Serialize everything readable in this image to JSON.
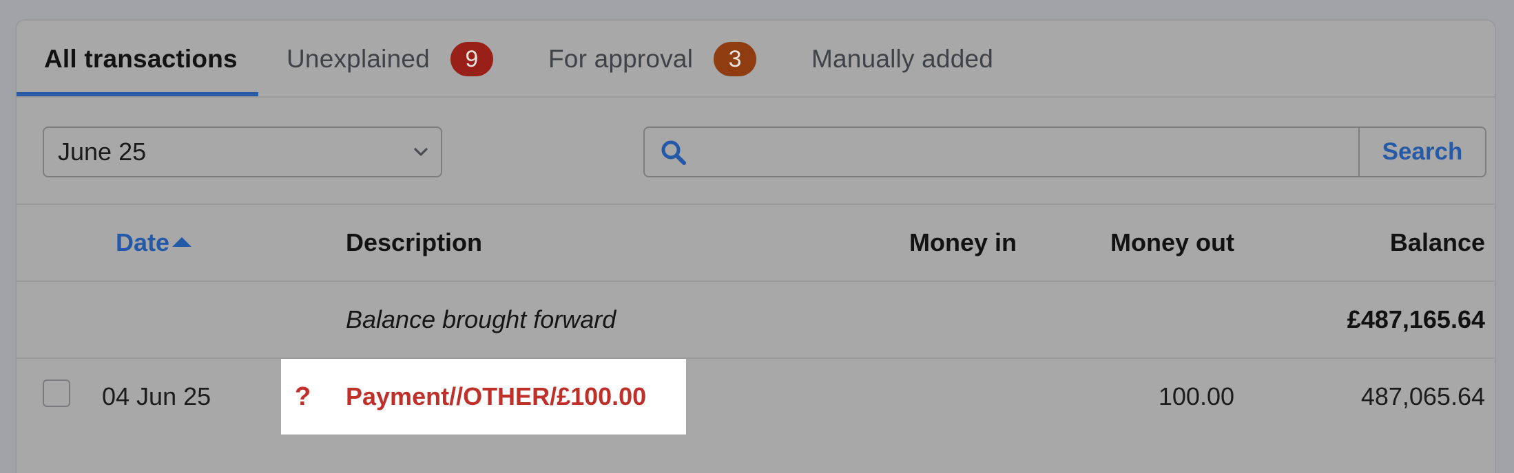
{
  "tabs": [
    {
      "label": "All transactions",
      "active": true
    },
    {
      "label": "Unexplained",
      "badge": "9",
      "badge_color": "#992018"
    },
    {
      "label": "For approval",
      "badge": "3",
      "badge_color": "#8f3d10"
    },
    {
      "label": "Manually added"
    }
  ],
  "filters": {
    "period_value": "June 25",
    "search_value": "",
    "search_button": "Search"
  },
  "table": {
    "columns": {
      "date": "Date",
      "description": "Description",
      "money_in": "Money in",
      "money_out": "Money out",
      "balance": "Balance"
    },
    "sort": {
      "column": "date",
      "direction": "ascending"
    },
    "carry_forward": {
      "description": "Balance brought forward",
      "balance": "£487,165.64"
    },
    "rows": [
      {
        "date": "04 Jun 25",
        "status_icon": "?",
        "description": "Payment//OTHER/£100.00",
        "money_in": "",
        "money_out": "100.00",
        "balance": "487,065.64"
      }
    ]
  },
  "colors": {
    "accent": "#2459a8",
    "unexplained": "#c0302b"
  }
}
